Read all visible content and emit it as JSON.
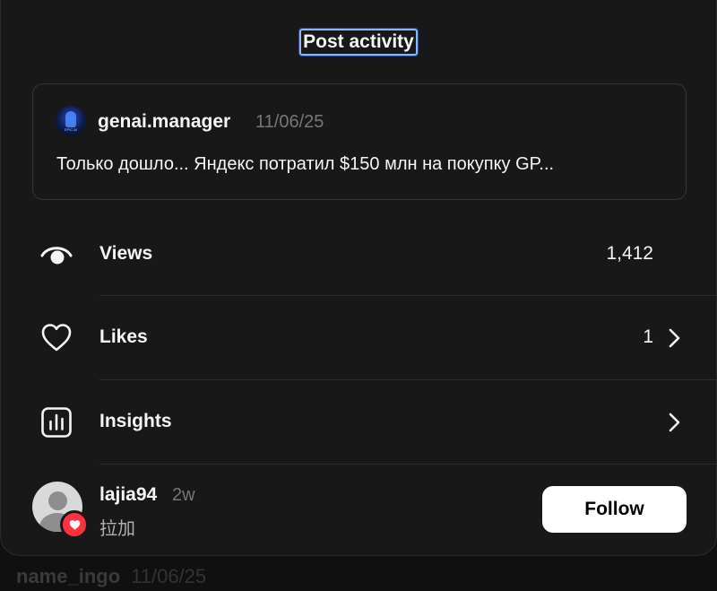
{
  "modal": {
    "title": "Post activity"
  },
  "post": {
    "username": "genai.manager",
    "date": "11/06/25",
    "text": "Только дошло... Яндекс потратил $150 млн на покупку GP...",
    "avatar_icon": "profile-avatar"
  },
  "stats": [
    {
      "label": "Views",
      "value": "1,412",
      "icon": "eye-icon",
      "has_chevron": false
    },
    {
      "label": "Likes",
      "value": "1",
      "icon": "heart-icon",
      "has_chevron": true
    },
    {
      "label": "Insights",
      "value": "",
      "icon": "bar-chart-icon",
      "has_chevron": true
    }
  ],
  "liker": {
    "username": "lajia94",
    "time": "2w",
    "full_name": "拉加",
    "follow_label": "Follow"
  },
  "background_post": {
    "username": "name_ingo",
    "date": "11/06/25"
  },
  "colors": {
    "background": "#101010",
    "modal": "#181818",
    "text_primary": "#f3f5f7",
    "text_secondary": "#777777",
    "like_badge": "#ff3040",
    "follow_button": "#ffffff"
  }
}
